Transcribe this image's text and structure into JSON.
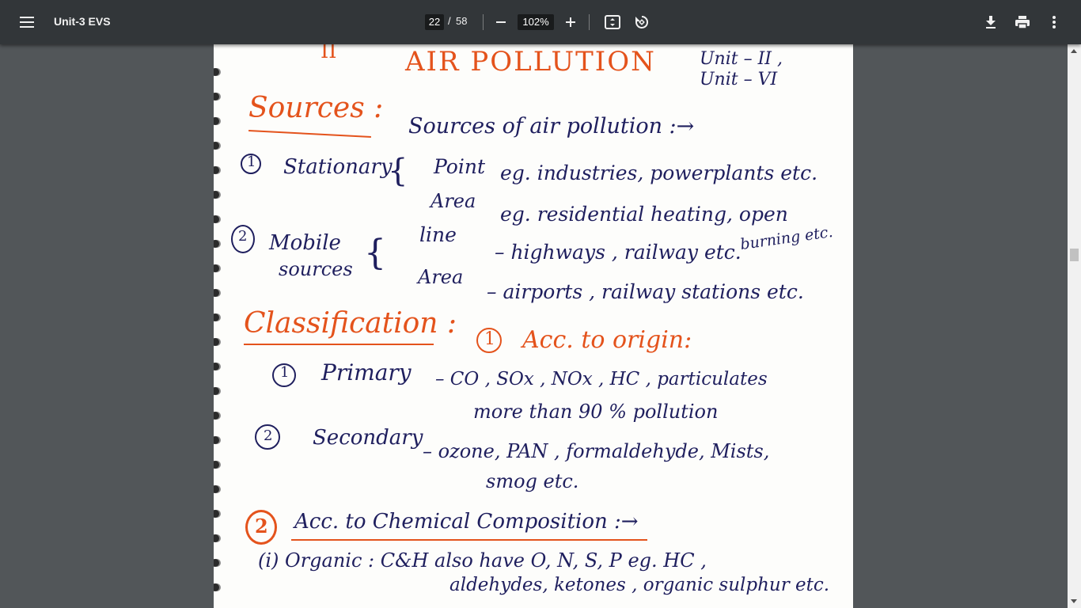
{
  "toolbar": {
    "menu_icon": "hamburger-menu-icon",
    "title": "Unit-3 EVS",
    "current_page": "22",
    "page_separator": "/",
    "total_pages": "58",
    "zoom": "102%",
    "icons": [
      "zoom-out-icon",
      "zoom-in-icon",
      "fit-to-page-icon",
      "rotate-icon",
      "download-icon",
      "print-icon",
      "more-vert-icon"
    ]
  },
  "notes": {
    "heading": "AIR POLLUTION",
    "heading_mark": "II",
    "unit_ref_1": "Unit – II ,",
    "unit_ref_2": "Unit – VI",
    "sources_title": "Sources :",
    "sources_subtitle": "Sources of air pollution :→",
    "stationary_num": "1",
    "stationary": "Stationary",
    "point": "Point",
    "point_eg": "eg. industries, powerplants etc.",
    "area": "Area",
    "area_eg": "eg. residential heating, open",
    "area_eg_2": "burning etc.",
    "mobile_num": "2",
    "mobile": "Mobile",
    "mobile_2": "sources",
    "line": "line",
    "line_eg": "– highways , railway etc.",
    "area_m": "Area",
    "area_m_eg": "– airports , railway stations etc.",
    "classification_title": "Classification :",
    "origin_num": "1",
    "origin": "Acc. to origin:",
    "primary_num": "1",
    "primary": "Primary",
    "primary_eg": "– CO , SOx , NOx , HC , particulates",
    "primary_eg_2": "more than 90 % pollution",
    "secondary_num": "2",
    "secondary": "Secondary",
    "secondary_eg": "– ozone, PAN , formaldehyde, Mists,",
    "secondary_eg_2": "smog etc.",
    "chem_num": "2",
    "chem": "Acc. to Chemical Composition :→",
    "organic": "(i) Organic : C&H also have O, N, S, P eg. HC ,",
    "organic_2": "aldehydes, ketones , organic sulphur etc."
  }
}
